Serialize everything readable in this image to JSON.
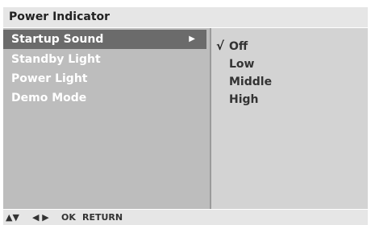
{
  "header": {
    "title": "Power Indicator"
  },
  "menu": {
    "items": [
      {
        "label": "Startup Sound",
        "arrow": "▶"
      },
      {
        "label": "Standby Light"
      },
      {
        "label": "Power Light"
      },
      {
        "label": "Demo Mode"
      }
    ]
  },
  "options": {
    "check_mark": "√",
    "items": [
      "Off",
      "Low",
      "Middle",
      "High"
    ]
  },
  "footer": {
    "updown_icon": "▲▼",
    "leftright_icon": "◀ ▶",
    "ok_label": "OK",
    "return_label": "RETURN"
  }
}
